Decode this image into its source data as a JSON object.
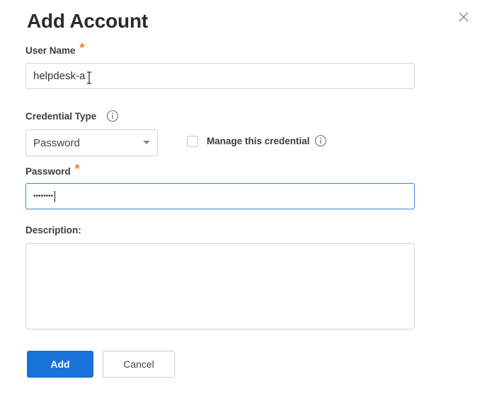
{
  "dialog": {
    "title": "Add Account",
    "close_icon": "close-icon"
  },
  "user_name": {
    "label": "User Name",
    "required_mark": "*",
    "value": "helpdesk-a"
  },
  "credential_type": {
    "label": "Credential Type",
    "info_icon": "info-icon",
    "selected": "Password",
    "dropdown_icon": "chevron-down-icon"
  },
  "manage_credential": {
    "label": "Manage this credential",
    "checked": false,
    "info_icon": "info-icon"
  },
  "password": {
    "label": "Password",
    "required_mark": "*",
    "value": "••••••••"
  },
  "description": {
    "label": "Description:",
    "value": ""
  },
  "buttons": {
    "add_label": "Add",
    "cancel_label": "Cancel"
  },
  "colors": {
    "primary": "#1a73d9",
    "required": "#f07f1d",
    "focus_border": "#4a90d9"
  }
}
